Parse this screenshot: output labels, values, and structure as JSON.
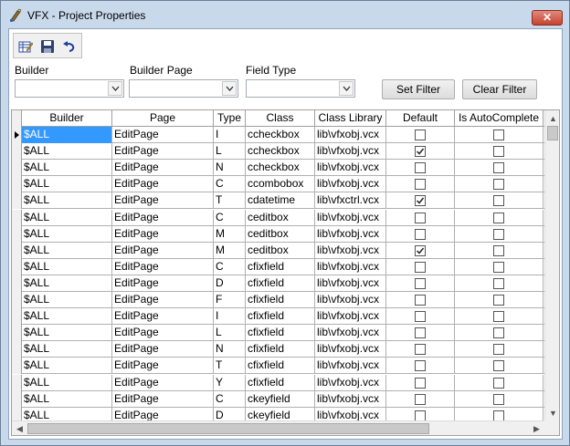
{
  "window": {
    "title": "VFX - Project Properties",
    "close_glyph": "✕"
  },
  "toolbar": {
    "icons": [
      "edit-grid-icon",
      "save-icon",
      "undo-icon"
    ]
  },
  "filters": {
    "builder_label": "Builder",
    "builder_page_label": "Builder Page",
    "field_type_label": "Field Type",
    "builder_value": "",
    "builder_page_value": "",
    "field_type_value": "",
    "set_filter_label": "Set Filter",
    "clear_filter_label": "Clear Filter"
  },
  "grid": {
    "columns": [
      "Builder",
      "Page",
      "Type",
      "Class",
      "Class Library",
      "Default",
      "Is AutoComplete"
    ],
    "rows": [
      {
        "builder": "$ALL",
        "page": "EditPage",
        "type": "I",
        "class": "ccheckbox",
        "library": "lib\\vfxobj.vcx",
        "default": false,
        "autocomplete": false
      },
      {
        "builder": "$ALL",
        "page": "EditPage",
        "type": "L",
        "class": "ccheckbox",
        "library": "lib\\vfxobj.vcx",
        "default": true,
        "autocomplete": false
      },
      {
        "builder": "$ALL",
        "page": "EditPage",
        "type": "N",
        "class": "ccheckbox",
        "library": "lib\\vfxobj.vcx",
        "default": false,
        "autocomplete": false
      },
      {
        "builder": "$ALL",
        "page": "EditPage",
        "type": "C",
        "class": "ccombobox",
        "library": "lib\\vfxobj.vcx",
        "default": false,
        "autocomplete": false
      },
      {
        "builder": "$ALL",
        "page": "EditPage",
        "type": "T",
        "class": "cdatetime",
        "library": "lib\\vfxctrl.vcx",
        "default": true,
        "autocomplete": false
      },
      {
        "builder": "$ALL",
        "page": "EditPage",
        "type": "C",
        "class": "ceditbox",
        "library": "lib\\vfxobj.vcx",
        "default": false,
        "autocomplete": false
      },
      {
        "builder": "$ALL",
        "page": "EditPage",
        "type": "M",
        "class": "ceditbox",
        "library": "lib\\vfxobj.vcx",
        "default": false,
        "autocomplete": false
      },
      {
        "builder": "$ALL",
        "page": "EditPage",
        "type": "M",
        "class": "ceditbox",
        "library": "lib\\vfxobj.vcx",
        "default": true,
        "autocomplete": false
      },
      {
        "builder": "$ALL",
        "page": "EditPage",
        "type": "C",
        "class": "cfixfield",
        "library": "lib\\vfxobj.vcx",
        "default": false,
        "autocomplete": false
      },
      {
        "builder": "$ALL",
        "page": "EditPage",
        "type": "D",
        "class": "cfixfield",
        "library": "lib\\vfxobj.vcx",
        "default": false,
        "autocomplete": false
      },
      {
        "builder": "$ALL",
        "page": "EditPage",
        "type": "F",
        "class": "cfixfield",
        "library": "lib\\vfxobj.vcx",
        "default": false,
        "autocomplete": false
      },
      {
        "builder": "$ALL",
        "page": "EditPage",
        "type": "I",
        "class": "cfixfield",
        "library": "lib\\vfxobj.vcx",
        "default": false,
        "autocomplete": false
      },
      {
        "builder": "$ALL",
        "page": "EditPage",
        "type": "L",
        "class": "cfixfield",
        "library": "lib\\vfxobj.vcx",
        "default": false,
        "autocomplete": false
      },
      {
        "builder": "$ALL",
        "page": "EditPage",
        "type": "N",
        "class": "cfixfield",
        "library": "lib\\vfxobj.vcx",
        "default": false,
        "autocomplete": false
      },
      {
        "builder": "$ALL",
        "page": "EditPage",
        "type": "T",
        "class": "cfixfield",
        "library": "lib\\vfxobj.vcx",
        "default": false,
        "autocomplete": false
      },
      {
        "builder": "$ALL",
        "page": "EditPage",
        "type": "Y",
        "class": "cfixfield",
        "library": "lib\\vfxobj.vcx",
        "default": false,
        "autocomplete": false
      },
      {
        "builder": "$ALL",
        "page": "EditPage",
        "type": "C",
        "class": "ckeyfield",
        "library": "lib\\vfxobj.vcx",
        "default": false,
        "autocomplete": false
      },
      {
        "builder": "$ALL",
        "page": "EditPage",
        "type": "D",
        "class": "ckeyfield",
        "library": "lib\\vfxobj.vcx",
        "default": false,
        "autocomplete": false
      }
    ]
  },
  "colors": {
    "selection": "#3399ff",
    "window_frame": "#c9d9ec"
  }
}
